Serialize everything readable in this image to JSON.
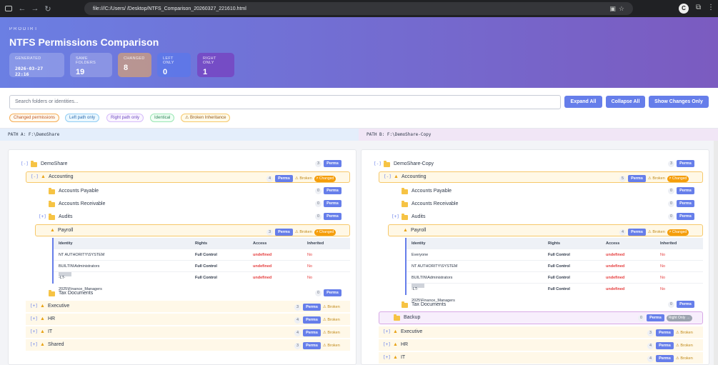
{
  "browser": {
    "url": "file:///C:/Users/      /Desktop/NTFS_Comparison_20260327_221610.html",
    "profile_initial": "C"
  },
  "header": {
    "brand": "PRODIRT",
    "title": "NTFS Permissions Comparison"
  },
  "stats": {
    "generated_label": "GENERATED",
    "generated_value": "2026-03-27 22:16",
    "same_label": "SAME FOLDERS",
    "same_value": "19",
    "changed_label": "CHANGED",
    "changed_value": "8",
    "left_label": "LEFT ONLY",
    "left_value": "0",
    "right_label": "RIGHT ONLY",
    "right_value": "1"
  },
  "toolbar": {
    "search_placeholder": "Search folders or identities...",
    "expand_all": "Expand All",
    "collapse_all": "Collapse All",
    "show_changes": "Show Changes Only"
  },
  "legend": {
    "changed": "Changed permissions",
    "left": "Left path only",
    "right": "Right path only",
    "identical": "Identical",
    "broken": "⚠ Broken Inheritance"
  },
  "paths": {
    "a": "PATH A: F:\\DemoShare",
    "b": "PATH B: F:\\DemoShare-Copy"
  },
  "labels": {
    "perms": "Perms",
    "broken": "⚠ Broken",
    "changed": "≠ Changed",
    "right_only": "Right Only →"
  },
  "table_headers": {
    "identity": "Identity",
    "rights": "Rights",
    "access": "Access",
    "inherited": "Inherited"
  },
  "left": {
    "root": {
      "toggle": "[-]",
      "name": "DemoShare",
      "count": "3"
    },
    "accounting": {
      "toggle": "[-]",
      "name": "Accounting",
      "count": "4"
    },
    "payable": {
      "name": "Accounts Payable",
      "count": "0"
    },
    "receivable": {
      "name": "Accounts Receivable",
      "count": "0"
    },
    "audits": {
      "toggle": "[+]",
      "name": "Audits",
      "count": "0"
    },
    "payroll": {
      "name": "Payroll",
      "count": "3"
    },
    "acl": [
      {
        "identity": "NT AUTHORITY\\SYSTEM",
        "rights": "Full Control",
        "access": "undefined",
        "inherited": "No"
      },
      {
        "identity": "BUILTIN\\Administrators",
        "rights": "Full Control",
        "access": "undefined",
        "inherited": "No"
      },
      {
        "identity": "-LT-2025\\Finance_Managers",
        "rights": "Full Control",
        "access": "undefined",
        "inherited": "No"
      }
    ],
    "tax": {
      "name": "Tax Documents",
      "count": "0"
    },
    "executive": {
      "toggle": "[+]",
      "name": "Executive",
      "count": "3"
    },
    "hr": {
      "toggle": "[+]",
      "name": "HR",
      "count": "4"
    },
    "it": {
      "toggle": "[+]",
      "name": "IT",
      "count": "4"
    },
    "shared": {
      "toggle": "[+]",
      "name": "Shared",
      "count": "3"
    }
  },
  "right": {
    "root": {
      "toggle": "[-]",
      "name": "DemoShare-Copy",
      "count": "3"
    },
    "accounting": {
      "toggle": "[-]",
      "name": "Accounting",
      "count": "5"
    },
    "payable": {
      "name": "Accounts Payable",
      "count": "0"
    },
    "receivable": {
      "name": "Accounts Receivable",
      "count": "0"
    },
    "audits": {
      "toggle": "[+]",
      "name": "Audits",
      "count": "0"
    },
    "payroll": {
      "name": "Payroll",
      "count": "4"
    },
    "acl": [
      {
        "identity": "Everyone",
        "rights": "Full Control",
        "access": "undefined",
        "inherited": "No"
      },
      {
        "identity": "NT AUTHORITY\\SYSTEM",
        "rights": "Full Control",
        "access": "undefined",
        "inherited": "No"
      },
      {
        "identity": "BUILTIN\\Administrators",
        "rights": "Full Control",
        "access": "undefined",
        "inherited": "No"
      },
      {
        "identity": "-LT-2025\\Finance_Managers",
        "rights": "Full Control",
        "access": "undefined",
        "inherited": "No"
      }
    ],
    "tax": {
      "name": "Tax Documents",
      "count": "0"
    },
    "backup": {
      "name": "Backup",
      "count": "0"
    },
    "executive": {
      "toggle": "[+]",
      "name": "Executive",
      "count": "3"
    },
    "hr": {
      "toggle": "[+]",
      "name": "HR",
      "count": "4"
    },
    "it": {
      "toggle": "[+]",
      "name": "IT",
      "count": "4"
    }
  },
  "colors": {
    "accent": "#667eea",
    "changed": "#f59e0b",
    "broken": "#e8a317",
    "undefined": "#e53e3e"
  }
}
